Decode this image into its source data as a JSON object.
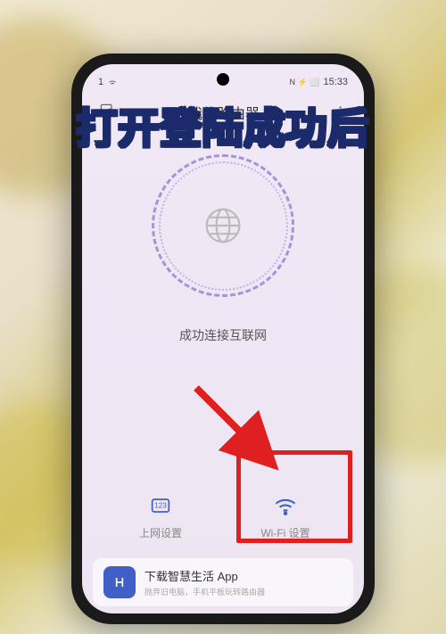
{
  "overlay": {
    "caption": "打开登陆成功后"
  },
  "status_bar": {
    "time": "15:33",
    "battery_indicator": "1",
    "icons": "N ⚡ ⬜"
  },
  "header": {
    "title": "我的路由器"
  },
  "main": {
    "connection_status": "成功连接互联网"
  },
  "nav": {
    "items": [
      {
        "label": "上网设置"
      },
      {
        "label": "Wi-Fi 设置"
      }
    ]
  },
  "banner": {
    "title": "下载智慧生活 App",
    "subtitle": "抛弃旧电脑，手机平板玩转路由器"
  }
}
